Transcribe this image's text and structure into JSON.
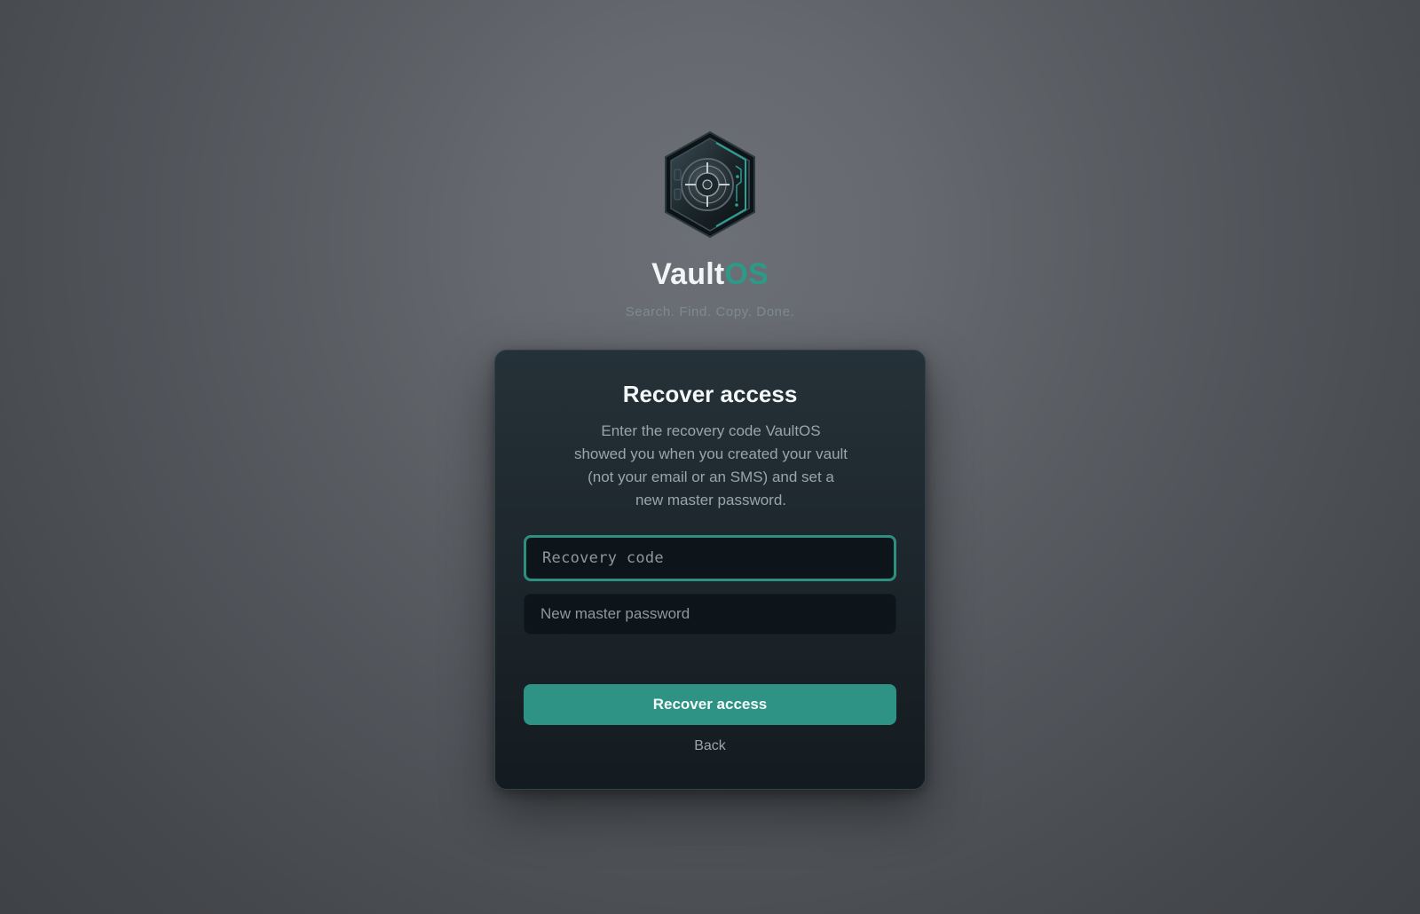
{
  "brand": {
    "name_main": "Vault",
    "name_accent": "OS",
    "tagline": "Search. Find. Copy. Done.",
    "logo_icon": "vault-safe-icon",
    "accent_color": "#2c9a88"
  },
  "card": {
    "title": "Recover access",
    "description": "Enter the recovery code VaultOS showed you when you created your vault (not your email or an SMS) and set a new master password.",
    "recovery_code_field": {
      "placeholder": "Recovery code",
      "value": ""
    },
    "new_password_field": {
      "placeholder": "New master password",
      "value": ""
    },
    "submit_label": "Recover access",
    "back_label": "Back"
  },
  "colors": {
    "primary": "#2e9384",
    "focus_border": "#2c8f80",
    "card_background": "#1d272d"
  }
}
